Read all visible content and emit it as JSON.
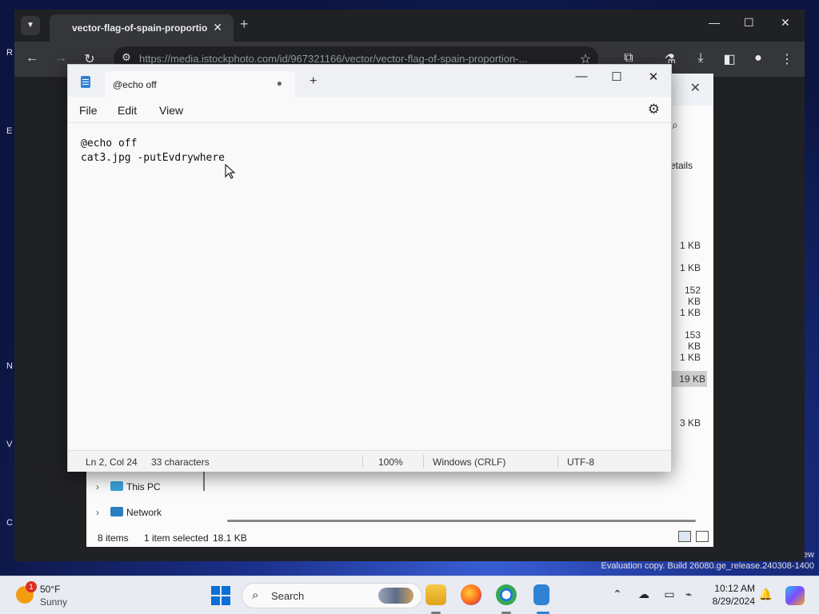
{
  "desktop": {
    "edge_letters": [
      "R",
      "E",
      "N",
      "V",
      "C"
    ],
    "watermark": "Evaluation copy. Build 26080.ge_release.240308-1400",
    "watermark_partial": "ew"
  },
  "chrome": {
    "tab_title": "vector-flag-of-spain-proportio",
    "url": "https://media.istockphoto.com/id/967321166/vector/vector-flag-of-spain-proportion-..."
  },
  "explorer": {
    "details_label": "etails",
    "sizes": [
      "1 KB",
      "1 KB",
      "152 KB",
      "1 KB",
      "153 KB",
      "1 KB",
      "19 KB",
      "3 KB"
    ],
    "nav": {
      "this_pc": "This PC",
      "network": "Network"
    },
    "status": {
      "items": "8 items",
      "selected": "1 item selected",
      "size": "18.1 KB"
    }
  },
  "notepad": {
    "tab_title": "@echo off",
    "menu": {
      "file": "File",
      "edit": "Edit",
      "view": "View"
    },
    "content": {
      "line1": "@echo off",
      "line2": "cat3.jpg -putEvdrywhere"
    },
    "status": {
      "position": "Ln 2, Col 24",
      "chars": "33 characters",
      "zoom": "100%",
      "line_ending": "Windows (CRLF)",
      "encoding": "UTF-8"
    }
  },
  "taskbar": {
    "weather": {
      "temp": "50°F",
      "condition": "Sunny",
      "badge": "1"
    },
    "search_label": "Search",
    "clock": {
      "time": "10:12 AM",
      "date": "8/29/2024"
    }
  },
  "colors": {
    "accent": "#0a6fd6",
    "chrome_dark": "#202124",
    "notepad_bg": "#f9f9f9"
  }
}
